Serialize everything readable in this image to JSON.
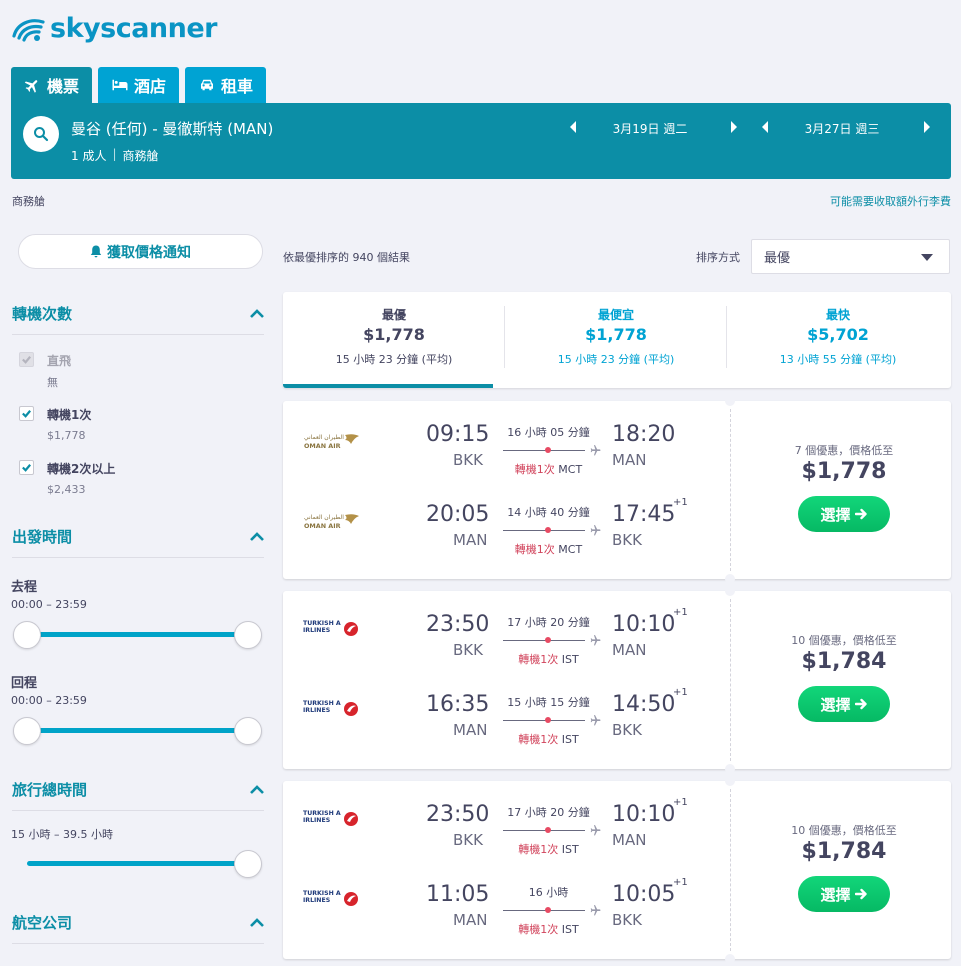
{
  "brand": {
    "name": "skyscanner"
  },
  "tabs": [
    {
      "label": "機票",
      "icon": "plane-icon",
      "active": true
    },
    {
      "label": "酒店",
      "icon": "bed-icon",
      "active": false
    },
    {
      "label": "租車",
      "icon": "car-icon",
      "active": false
    }
  ],
  "search": {
    "route": "曼谷 (任何) - 曼徹斯特 (MAN)",
    "passengers": "1 成人",
    "cabin": "商務艙",
    "depart_date": "3月19日 週二",
    "return_date": "3月27日 週三"
  },
  "cabin_label": "商務艙",
  "baggage_note": "可能需要收取額外行李費",
  "price_alert_label": "獲取價格通知",
  "filters": {
    "stops": {
      "title": "轉機次數",
      "options": [
        {
          "label": "直飛",
          "sub": "無",
          "checked": true,
          "disabled": true
        },
        {
          "label": "轉機1次",
          "sub": "$1,778",
          "checked": true,
          "disabled": false
        },
        {
          "label": "轉機2次以上",
          "sub": "$2,433",
          "checked": true,
          "disabled": false
        }
      ]
    },
    "times": {
      "title": "出發時間",
      "outbound_label": "去程",
      "outbound_range": "00:00 – 23:59",
      "return_label": "回程",
      "return_range": "00:00 – 23:59"
    },
    "duration": {
      "title": "旅行總時間",
      "range": "15 小時 – 39.5 小時"
    },
    "airlines": {
      "title": "航空公司"
    }
  },
  "results": {
    "count_text": "依最優排序的 940 個結果",
    "sort_label": "排序方式",
    "sort_value": "最優"
  },
  "summary": [
    {
      "title": "最優",
      "price": "$1,778",
      "duration": "15 小時 23 分鐘 (平均)"
    },
    {
      "title": "最便宜",
      "price": "$1,778",
      "duration": "15 小時 23 分鐘 (平均)"
    },
    {
      "title": "最快",
      "price": "$5,702",
      "duration": "13 小時 55 分鐘 (平均)"
    }
  ],
  "flights": [
    {
      "airline": "OMAN AIR",
      "airline_script": "الطيران العماني",
      "logo": "oman-air-logo",
      "legs": [
        {
          "dep_time": "09:15",
          "dep_airport": "BKK",
          "arr_time": "18:20",
          "arr_airport": "MAN",
          "plus": "",
          "duration": "16 小時 05 分鐘",
          "stops": "轉機1次",
          "via": "MCT"
        },
        {
          "dep_time": "20:05",
          "dep_airport": "MAN",
          "arr_time": "17:45",
          "arr_airport": "BKK",
          "plus": "+1",
          "duration": "14 小時 40 分鐘",
          "stops": "轉機1次",
          "via": "MCT"
        }
      ],
      "deals": "7 個優惠，價格低至",
      "price": "$1,778",
      "select_label": "選擇"
    },
    {
      "airline": "TURKISH AIRLINES",
      "logo": "turkish-airlines-logo",
      "legs": [
        {
          "dep_time": "23:50",
          "dep_airport": "BKK",
          "arr_time": "10:10",
          "arr_airport": "MAN",
          "plus": "+1",
          "duration": "17 小時 20 分鐘",
          "stops": "轉機1次",
          "via": "IST"
        },
        {
          "dep_time": "16:35",
          "dep_airport": "MAN",
          "arr_time": "14:50",
          "arr_airport": "BKK",
          "plus": "+1",
          "duration": "15 小時 15 分鐘",
          "stops": "轉機1次",
          "via": "IST"
        }
      ],
      "deals": "10 個優惠，價格低至",
      "price": "$1,784",
      "select_label": "選擇"
    },
    {
      "airline": "TURKISH AIRLINES",
      "logo": "turkish-airlines-logo",
      "legs": [
        {
          "dep_time": "23:50",
          "dep_airport": "BKK",
          "arr_time": "10:10",
          "arr_airport": "MAN",
          "plus": "+1",
          "duration": "17 小時 20 分鐘",
          "stops": "轉機1次",
          "via": "IST"
        },
        {
          "dep_time": "11:05",
          "dep_airport": "MAN",
          "arr_time": "10:05",
          "arr_airport": "BKK",
          "plus": "+1",
          "duration": "16 小時",
          "stops": "轉機1次",
          "via": "IST"
        }
      ],
      "deals": "10 個優惠，價格低至",
      "price": "$1,784",
      "select_label": "選擇"
    }
  ]
}
